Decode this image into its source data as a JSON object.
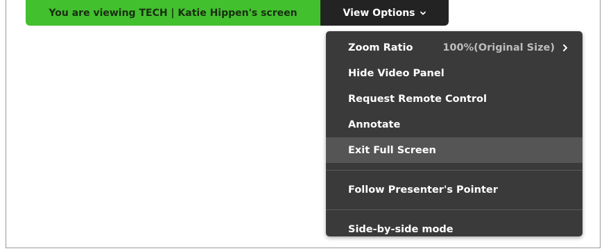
{
  "banner": {
    "text": "You are viewing TECH | Katie Hippen's screen",
    "color": "#42c02e"
  },
  "view_options": {
    "label": "View Options",
    "icon": "chevron-down-icon"
  },
  "menu": {
    "zoom_ratio": {
      "label": "Zoom Ratio",
      "value": "100%(Original Size)",
      "icon": "chevron-right-icon"
    },
    "hide_video_panel": "Hide Video Panel",
    "request_remote_control": "Request Remote Control",
    "annotate": "Annotate",
    "exit_full_screen": "Exit Full Screen",
    "follow_presenter_pointer": "Follow Presenter's Pointer",
    "side_by_side_mode": "Side-by-side mode",
    "highlighted_item": "Exit Full Screen"
  },
  "colors": {
    "menu_bg": "#3a3a3a",
    "menu_hover": "#555555",
    "toolbar_bg": "#232323"
  }
}
